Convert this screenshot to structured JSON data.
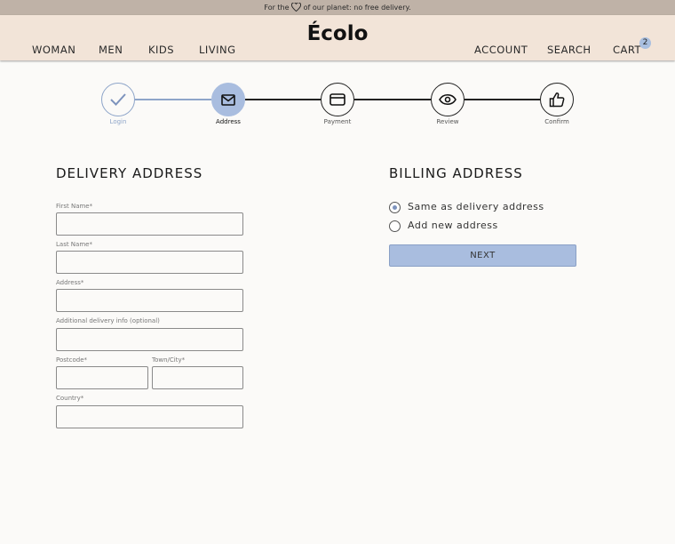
{
  "promo": {
    "before": "For the",
    "after": "of our planet: no free delivery."
  },
  "header": {
    "logo": "Écolo",
    "nav_left": [
      "WOMAN",
      "MEN",
      "KIDS",
      "LIVING"
    ],
    "account": "ACCOUNT",
    "search": "SEARCH",
    "cart": "CART",
    "cart_count": "2"
  },
  "steps": [
    {
      "label": "Login",
      "state": "done"
    },
    {
      "label": "Address",
      "state": "active"
    },
    {
      "label": "Payment",
      "state": "todo"
    },
    {
      "label": "Review",
      "state": "todo"
    },
    {
      "label": "Confirm",
      "state": "todo"
    }
  ],
  "delivery": {
    "title": "DELIVERY ADDRESS",
    "first_name": "First Name*",
    "last_name": "Last Name*",
    "address": "Address*",
    "additional": "Additional delivery info (optional)",
    "postcode": "Postcode*",
    "town": "Town/City*",
    "country": "Country*"
  },
  "billing": {
    "title": "BILLING ADDRESS",
    "option_same": "Same as delivery address",
    "option_new": "Add new address",
    "selected": "same",
    "next": "NEXT"
  },
  "colors": {
    "accent": "#a9bddf",
    "header": "#f2e4d8",
    "promo": "#bfb2a7"
  }
}
